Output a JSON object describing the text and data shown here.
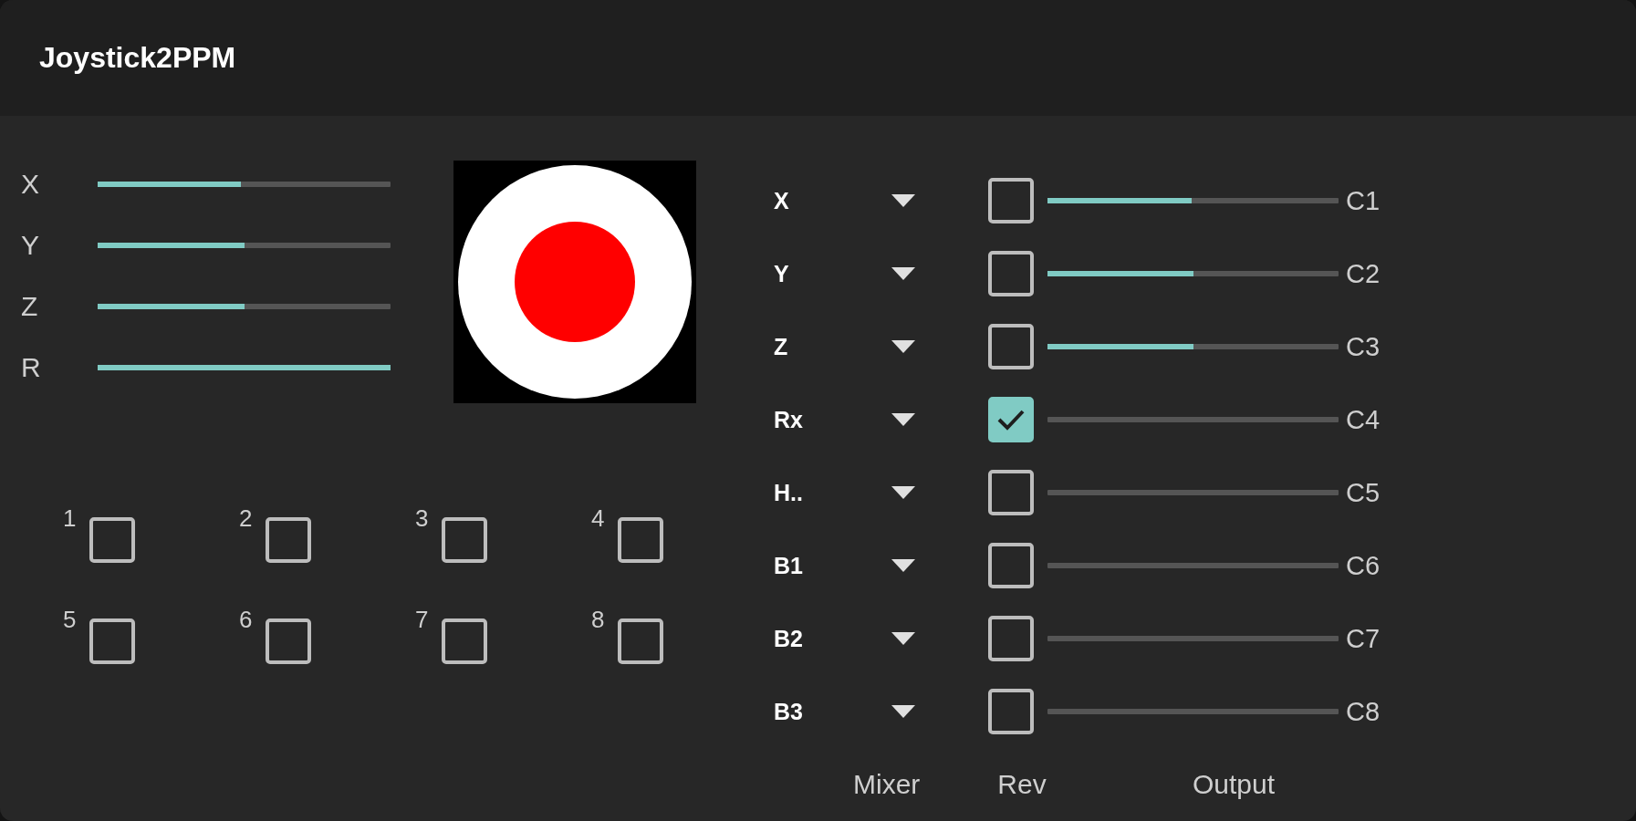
{
  "window": {
    "title": "Joystick2PPM"
  },
  "axes": [
    {
      "label": "X",
      "level": 0.49
    },
    {
      "label": "Y",
      "level": 0.5
    },
    {
      "label": "Z",
      "level": 0.5
    },
    {
      "label": "R",
      "level": 1
    }
  ],
  "buttons": [
    {
      "label": "1",
      "checked": false
    },
    {
      "label": "2",
      "checked": false
    },
    {
      "label": "3",
      "checked": false
    },
    {
      "label": "4",
      "checked": false
    },
    {
      "label": "5",
      "checked": false
    },
    {
      "label": "6",
      "checked": false
    },
    {
      "label": "7",
      "checked": false
    },
    {
      "label": "8",
      "checked": false
    }
  ],
  "channels": [
    {
      "mixer": "X",
      "checked": false,
      "level": 0.495,
      "output": "C1"
    },
    {
      "mixer": "Y",
      "checked": false,
      "level": 0.5,
      "output": "C2"
    },
    {
      "mixer": "Z",
      "checked": false,
      "level": 0.5,
      "output": "C3"
    },
    {
      "mixer": "Rx",
      "checked": true,
      "level": 0,
      "output": "C4"
    },
    {
      "mixer": "H..",
      "checked": false,
      "level": 0,
      "output": "C5"
    },
    {
      "mixer": "B1",
      "checked": false,
      "level": 0,
      "output": "C6"
    },
    {
      "mixer": "B2",
      "checked": false,
      "level": 0,
      "output": "C7"
    },
    {
      "mixer": "B3",
      "checked": false,
      "level": 0,
      "output": "C8"
    }
  ],
  "footer": [
    "Mixer",
    "Rev",
    "Output"
  ]
}
